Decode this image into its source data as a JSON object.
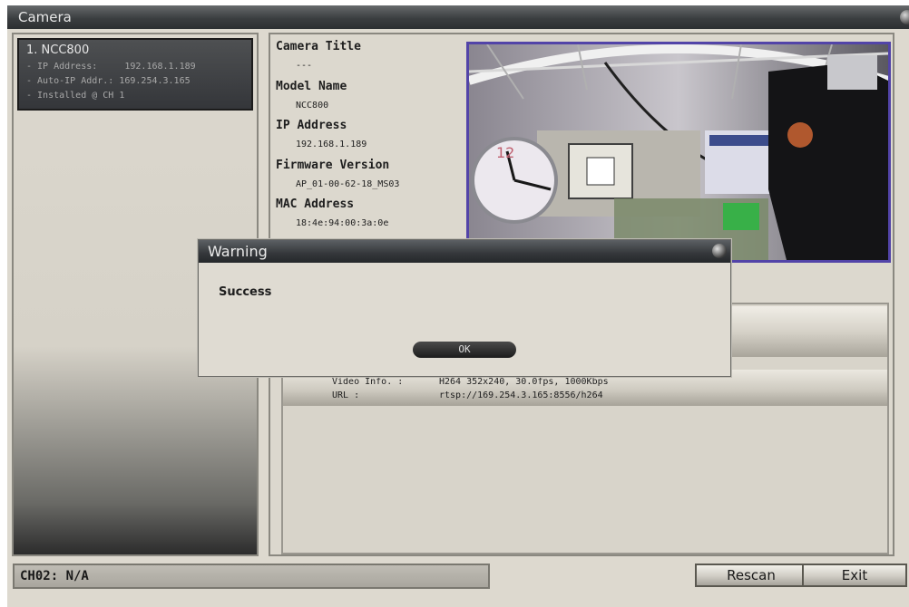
{
  "window": {
    "title": "Camera"
  },
  "camera_list": [
    {
      "name": "1. NCC800",
      "lines": [
        "- IP Address:     192.168.1.189",
        "- Auto-IP Addr.: 169.254.3.165",
        "- Installed @ CH 1"
      ]
    }
  ],
  "info": {
    "camera_title_label": "Camera Title",
    "camera_title_value": "---",
    "model_name_label": "Model Name",
    "model_name_value": "NCC800",
    "ip_address_label": "IP Address",
    "ip_address_value": "192.168.1.189",
    "firmware_label": "Firmware Version",
    "firmware_value": "AP_01-00-62-18_MS03",
    "mac_label": "MAC Address",
    "mac_value": "18:4e:94:00:3a:0e"
  },
  "stream": {
    "video_info_label": "Video Info. :",
    "video_info_value": "H264 352x240, 30.0fps, 1000Kbps",
    "url_label": "URL :",
    "url_value": "rtsp://169.254.3.165:8556/h264"
  },
  "status": {
    "text": "CH02: N/A"
  },
  "buttons": {
    "rescan": "Rescan",
    "exit": "Exit"
  },
  "dialog": {
    "title": "Warning",
    "message": "Success",
    "ok": "OK"
  },
  "colors": {
    "preview_border": "#5244a8",
    "titlebar": "#3b3e40"
  }
}
